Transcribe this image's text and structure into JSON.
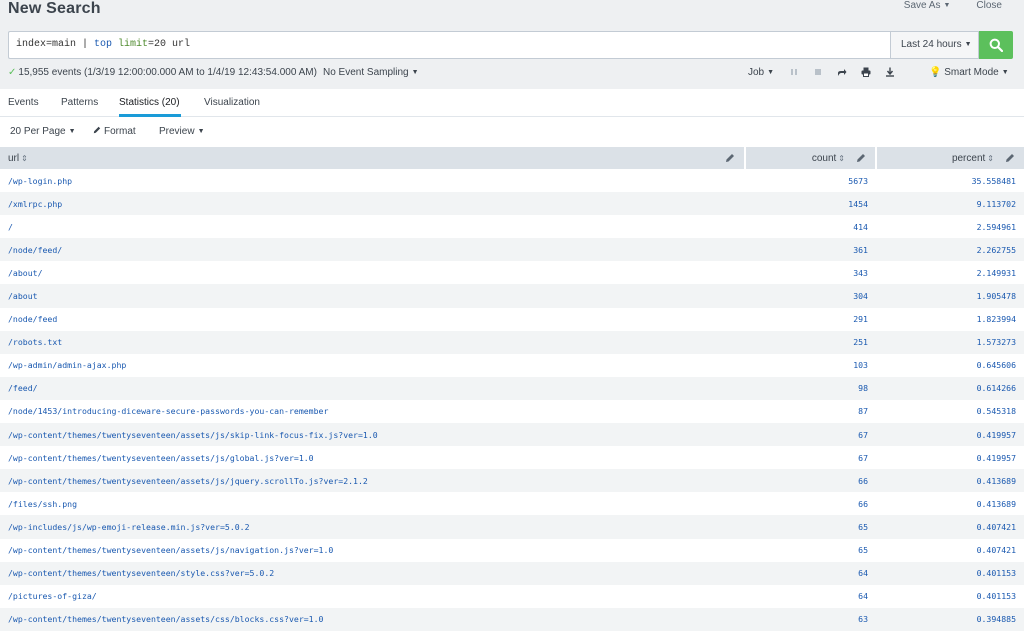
{
  "header": {
    "title": "New Search",
    "save_as": "Save As",
    "close": "Close"
  },
  "search": {
    "query_index": "index=main | ",
    "query_cmd": "top",
    "query_arg": " limit",
    "query_rest": "=20 url",
    "time_range": "Last 24 hours"
  },
  "status": {
    "summary": "15,955 events (1/3/19 12:00:00.000 AM to 1/4/19 12:43:54.000 AM)",
    "sampling": "No Event Sampling",
    "job": "Job",
    "mode": "Smart Mode"
  },
  "tabs": [
    "Events",
    "Patterns",
    "Statistics (20)",
    "Visualization"
  ],
  "toolbar": {
    "per_page": "20 Per Page",
    "format": "Format",
    "preview": "Preview"
  },
  "table": {
    "columns": [
      "url",
      "count",
      "percent"
    ],
    "rows": [
      [
        "/wp-login.php",
        "5673",
        "35.558481"
      ],
      [
        "/xmlrpc.php",
        "1454",
        "9.113702"
      ],
      [
        "/",
        "414",
        "2.594961"
      ],
      [
        "/node/feed/",
        "361",
        "2.262755"
      ],
      [
        "/about/",
        "343",
        "2.149931"
      ],
      [
        "/about",
        "304",
        "1.905478"
      ],
      [
        "/node/feed",
        "291",
        "1.823994"
      ],
      [
        "/robots.txt",
        "251",
        "1.573273"
      ],
      [
        "/wp-admin/admin-ajax.php",
        "103",
        "0.645606"
      ],
      [
        "/feed/",
        "98",
        "0.614266"
      ],
      [
        "/node/1453/introducing-diceware-secure-passwords-you-can-remember",
        "87",
        "0.545318"
      ],
      [
        "/wp-content/themes/twentyseventeen/assets/js/skip-link-focus-fix.js?ver=1.0",
        "67",
        "0.419957"
      ],
      [
        "/wp-content/themes/twentyseventeen/assets/js/global.js?ver=1.0",
        "67",
        "0.419957"
      ],
      [
        "/wp-content/themes/twentyseventeen/assets/js/jquery.scrollTo.js?ver=2.1.2",
        "66",
        "0.413689"
      ],
      [
        "/files/ssh.png",
        "66",
        "0.413689"
      ],
      [
        "/wp-includes/js/wp-emoji-release.min.js?ver=5.0.2",
        "65",
        "0.407421"
      ],
      [
        "/wp-content/themes/twentyseventeen/assets/js/navigation.js?ver=1.0",
        "65",
        "0.407421"
      ],
      [
        "/wp-content/themes/twentyseventeen/style.css?ver=5.0.2",
        "64",
        "0.401153"
      ],
      [
        "/pictures-of-giza/",
        "64",
        "0.401153"
      ],
      [
        "/wp-content/themes/twentyseventeen/assets/css/blocks.css?ver=1.0",
        "63",
        "0.394885"
      ]
    ]
  },
  "colors": {
    "link": "#1a59b0",
    "accent_green": "#5cc05c",
    "tab_underline": "#1a9bd8",
    "header_bg": "#dbe1e7"
  },
  "icons": [
    "search-icon",
    "pause-icon",
    "stop-icon",
    "share-icon",
    "print-icon",
    "export-icon",
    "bulb-icon",
    "pencil-icon"
  ]
}
